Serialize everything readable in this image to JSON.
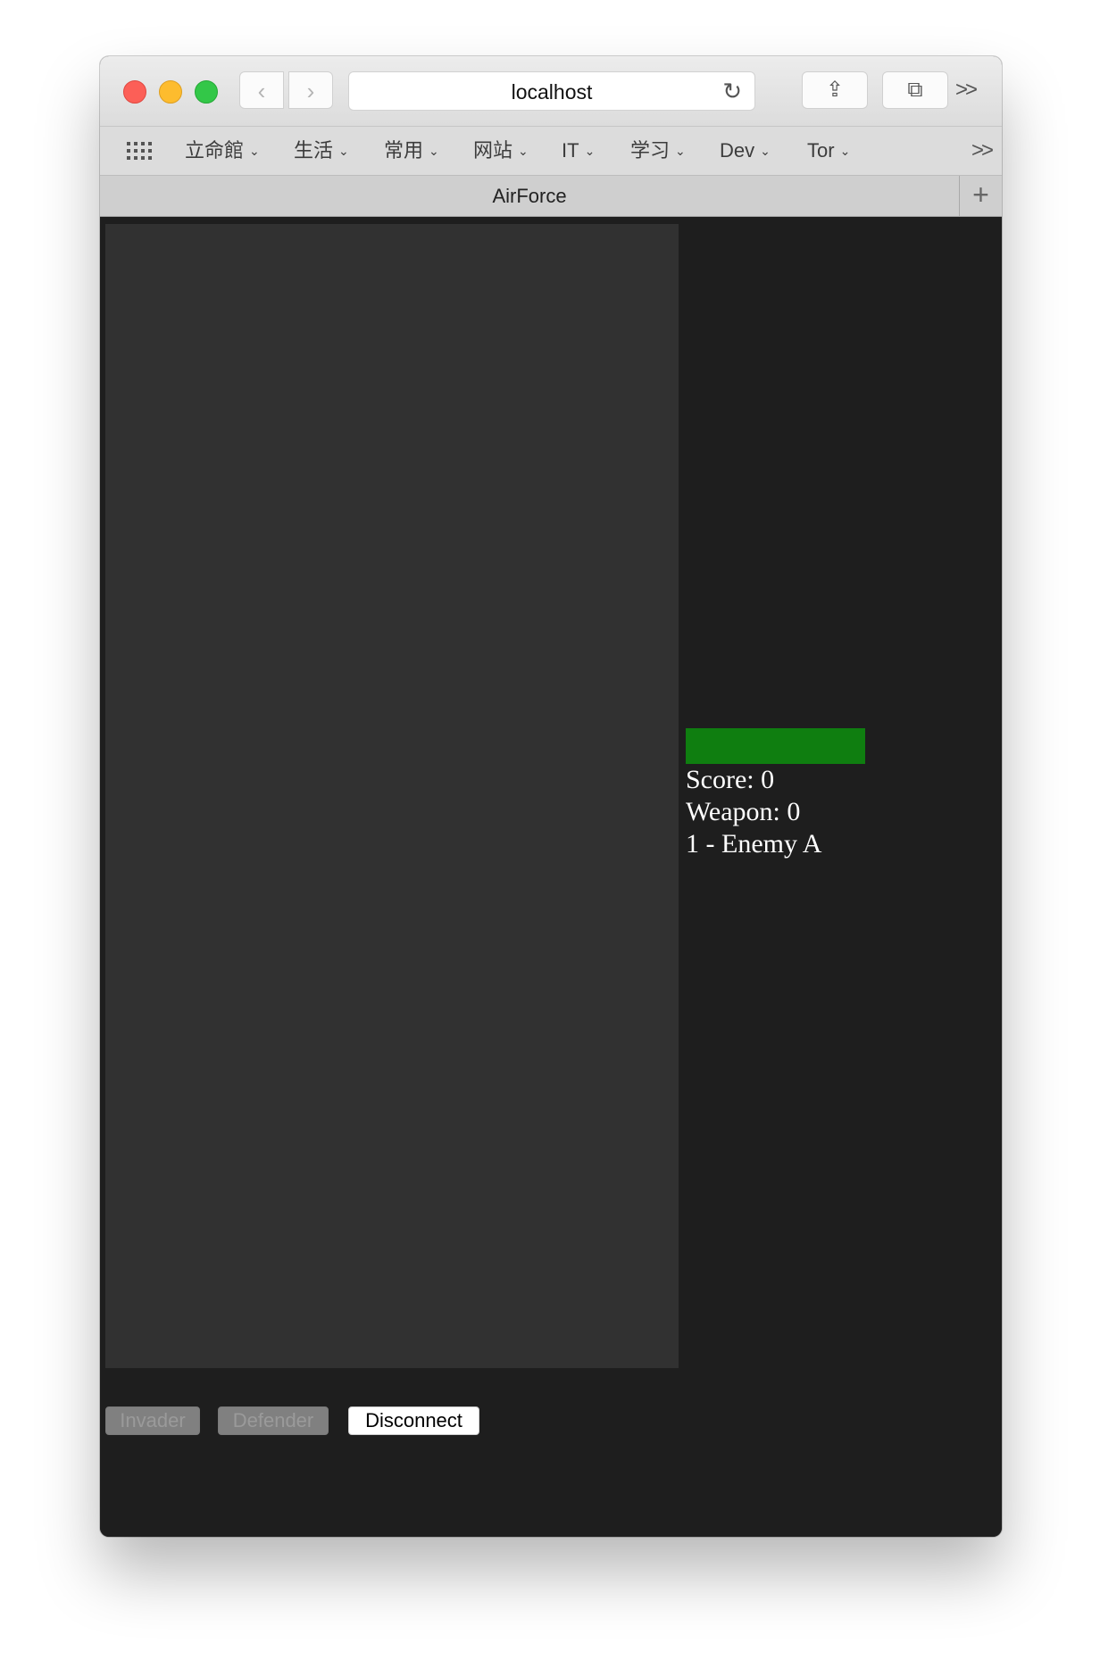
{
  "browser": {
    "address": "localhost",
    "back_glyph": "‹",
    "forward_glyph": "›",
    "reload_glyph": "↻",
    "share_glyph": "⇪",
    "tabs_glyph": "⧉",
    "overflow_glyph": ">>",
    "bookmarks": [
      {
        "label": "立命館",
        "chevron": "⌄"
      },
      {
        "label": "生活",
        "chevron": "⌄"
      },
      {
        "label": "常用",
        "chevron": "⌄"
      },
      {
        "label": "网站",
        "chevron": "⌄"
      },
      {
        "label": "IT",
        "chevron": "⌄"
      },
      {
        "label": "学习",
        "chevron": "⌄"
      },
      {
        "label": "Dev",
        "chevron": "⌄"
      },
      {
        "label": "Tor",
        "chevron": "⌄"
      }
    ],
    "bookmarks_overflow": ">>",
    "tab_title": "AirForce",
    "new_tab_glyph": "+",
    "traffic_light_colors": {
      "close": "#fc5f57",
      "minimize": "#fdbc2e",
      "zoom": "#33c748"
    }
  },
  "game": {
    "health_bar_color": "#0f7e10",
    "health_fraction": 1.0,
    "score": "Score: 0",
    "weapon": "Weapon: 0",
    "enemy": "1 - Enemy A",
    "buttons": {
      "invader": "Invader",
      "defender": "Defender",
      "disconnect": "Disconnect"
    }
  }
}
